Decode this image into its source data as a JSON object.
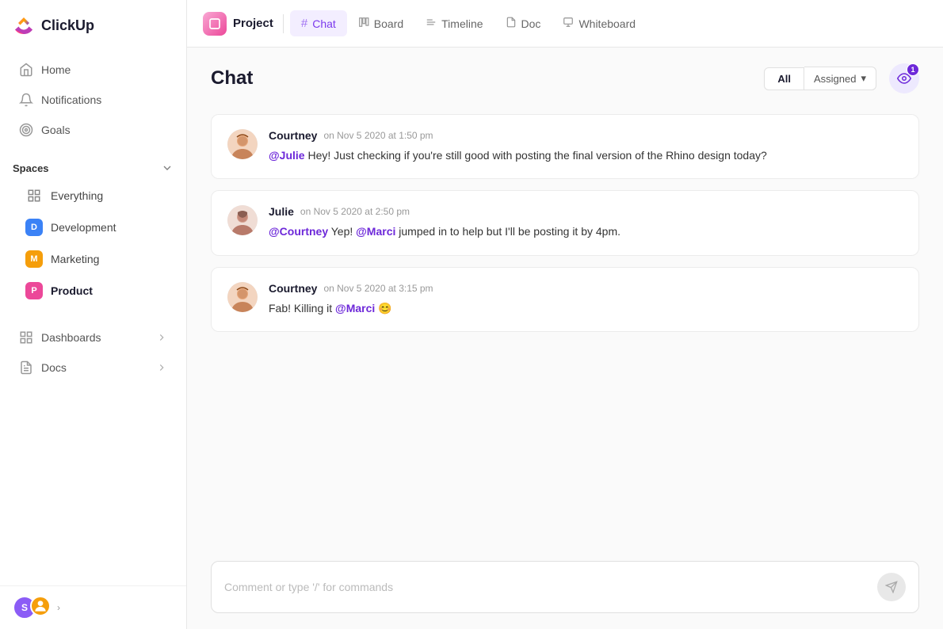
{
  "app": {
    "name": "ClickUp"
  },
  "sidebar": {
    "nav": [
      {
        "id": "home",
        "label": "Home",
        "icon": "home"
      },
      {
        "id": "notifications",
        "label": "Notifications",
        "icon": "bell"
      },
      {
        "id": "goals",
        "label": "Goals",
        "icon": "target"
      }
    ],
    "spaces_label": "Spaces",
    "spaces": [
      {
        "id": "everything",
        "label": "Everything",
        "type": "everything"
      },
      {
        "id": "development",
        "label": "Development",
        "type": "badge",
        "color": "#3b82f6",
        "letter": "D"
      },
      {
        "id": "marketing",
        "label": "Marketing",
        "type": "badge",
        "color": "#f59e0b",
        "letter": "M"
      },
      {
        "id": "product",
        "label": "Product",
        "type": "badge",
        "color": "#ec4899",
        "letter": "P",
        "active": true
      }
    ],
    "expandable": [
      {
        "id": "dashboards",
        "label": "Dashboards"
      },
      {
        "id": "docs",
        "label": "Docs"
      }
    ],
    "footer": {
      "avatar1_letter": "S",
      "chevron": "›"
    }
  },
  "topbar": {
    "project_label": "Project",
    "tabs": [
      {
        "id": "chat",
        "label": "Chat",
        "icon": "#",
        "active": true
      },
      {
        "id": "board",
        "label": "Board",
        "icon": "☰"
      },
      {
        "id": "timeline",
        "label": "Timeline",
        "icon": "—"
      },
      {
        "id": "doc",
        "label": "Doc",
        "icon": "☐"
      },
      {
        "id": "whiteboard",
        "label": "Whiteboard",
        "icon": "✎"
      }
    ]
  },
  "chat": {
    "title": "Chat",
    "filters": {
      "all_label": "All",
      "assigned_label": "Assigned",
      "chevron": "▾"
    },
    "eye_badge": "1",
    "messages": [
      {
        "id": "msg1",
        "author": "Courtney",
        "time": "on Nov 5 2020 at 1:50 pm",
        "text_parts": [
          {
            "type": "mention",
            "text": "@Julie"
          },
          {
            "type": "text",
            "text": " Hey! Just checking if you're still good with posting the final version of the Rhino design today?"
          }
        ]
      },
      {
        "id": "msg2",
        "author": "Julie",
        "time": "on Nov 5 2020 at 2:50 pm",
        "text_parts": [
          {
            "type": "mention",
            "text": "@Courtney"
          },
          {
            "type": "text",
            "text": " Yep! "
          },
          {
            "type": "mention",
            "text": "@Marci"
          },
          {
            "type": "text",
            "text": " jumped in to help but I'll be posting it by 4pm."
          }
        ]
      },
      {
        "id": "msg3",
        "author": "Courtney",
        "time": "on Nov 5 2020 at 3:15 pm",
        "text_parts": [
          {
            "type": "text",
            "text": "Fab! Killing it "
          },
          {
            "type": "mention",
            "text": "@Marci"
          },
          {
            "type": "text",
            "text": " 😊"
          }
        ]
      }
    ],
    "input_placeholder": "Comment or type '/' for commands"
  }
}
